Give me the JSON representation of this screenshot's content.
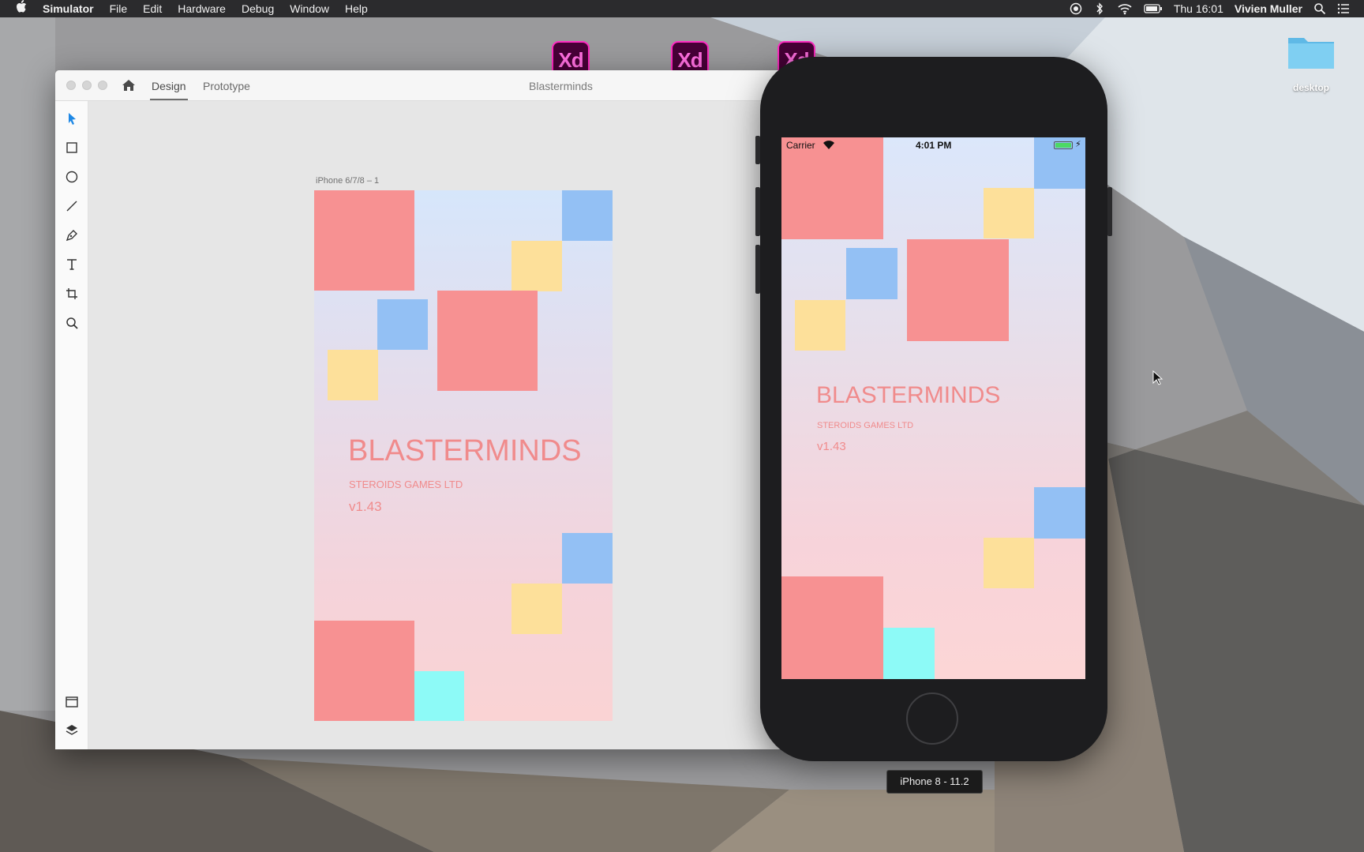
{
  "menubar": {
    "apple": "",
    "app_name": "Simulator",
    "menus": [
      "File",
      "Edit",
      "Hardware",
      "Debug",
      "Window",
      "Help"
    ],
    "clock": "Thu 16:01",
    "user": "Vivien Muller"
  },
  "desktop": {
    "xd_icon_label": "Xd",
    "folder_label": "desktop"
  },
  "xd_window": {
    "tabs": [
      "Design",
      "Prototype"
    ],
    "active_tab": "Design",
    "document_title": "Blasterminds",
    "artboard_name": "iPhone 6/7/8 – 1"
  },
  "game": {
    "title": "BLASTERMINDS",
    "studio": "STEROIDS GAMES LTD",
    "version": "v1.43"
  },
  "simulator": {
    "carrier": "Carrier",
    "time": "4:01 PM",
    "device_label": "iPhone 8 - 11.2"
  },
  "colors": {
    "red": "#f79192",
    "blue": "#93c0f4",
    "yellow": "#fde09a",
    "cyan": "#8dfaf7",
    "title_pink": "#f08b8c",
    "xd_magenta": "#ff2bc2"
  }
}
